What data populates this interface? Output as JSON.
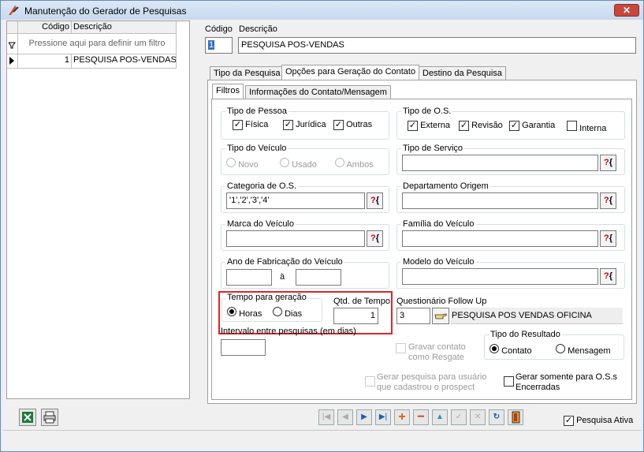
{
  "window": {
    "title": "Manutenção do Gerador de Pesquisas",
    "close": "✕"
  },
  "list": {
    "col_code": "Código",
    "col_desc": "Descrição",
    "filter_hint": "Pressione aqui para definir um filtro",
    "rows": [
      {
        "code": "1",
        "desc": "PESQUISA POS-VENDAS"
      }
    ]
  },
  "header": {
    "code_label": "Código",
    "desc_label": "Descrição",
    "code_value": "1",
    "desc_value": "PESQUISA POS-VENDAS"
  },
  "tabs": [
    "Tipo da Pesquisa",
    "Opções para Geração do Contato",
    "Destino da Pesquisa"
  ],
  "subtabs": [
    "Filtros",
    "Informações do Contato/Mensagem"
  ],
  "tipo_pessoa": {
    "label": "Tipo de Pessoa",
    "options": [
      {
        "label": "Física",
        "checked": true
      },
      {
        "label": "Jurídica",
        "checked": true
      },
      {
        "label": "Outras",
        "checked": true
      }
    ]
  },
  "tipo_os": {
    "label": "Tipo de O.S.",
    "options": [
      {
        "label": "Externa",
        "checked": true
      },
      {
        "label": "Revisão",
        "checked": true
      },
      {
        "label": "Garantia",
        "checked": true
      },
      {
        "label": "Interna",
        "checked": false
      }
    ]
  },
  "tipo_veiculo": {
    "label": "Tipo do Veículo",
    "options": [
      "Novo",
      "Usado",
      "Ambos"
    ]
  },
  "tipo_servico": {
    "label": "Tipo de Serviço",
    "value": ""
  },
  "categoria_os": {
    "label": "Categoria de O.S.",
    "value": "'1','2','3','4'"
  },
  "depto_origem": {
    "label": "Departamento Origem",
    "value": ""
  },
  "marca": {
    "label": "Marca do Veículo",
    "value": ""
  },
  "familia": {
    "label": "Família do Veículo",
    "value": ""
  },
  "ano": {
    "label": "Ano de Fabricação do Veículo",
    "sep": "à",
    "from": "",
    "to": ""
  },
  "modelo": {
    "label": "Modelo do Veículo",
    "value": ""
  },
  "tempo": {
    "label": "Tempo para geração",
    "options": [
      {
        "label": "Horas",
        "selected": true
      },
      {
        "label": "Dias",
        "selected": false
      }
    ]
  },
  "qtd_tempo": {
    "label": "Qtd. de Tempo",
    "value": "1"
  },
  "questionario": {
    "label": "Questionário Follow Up",
    "code": "3",
    "desc": "PESQUISA POS VENDAS OFICINA"
  },
  "intervalo": {
    "label": "Intervalo entre pesquisas (em dias)",
    "value": ""
  },
  "gravar": {
    "label1": "Gravar contato",
    "label2": "como Resgate"
  },
  "tipo_resultado": {
    "label": "Tipo do Resultado",
    "options": [
      {
        "label": "Contato",
        "selected": true
      },
      {
        "label": "Mensagem",
        "selected": false
      }
    ]
  },
  "gerar_usuario": {
    "label1": "Gerar pesquisa para usuário",
    "label2": "que cadastrou o prospect"
  },
  "gerar_os": {
    "label1": "Gerar somente para O.S.s",
    "label2": "Encerradas"
  },
  "ativa": {
    "label": "Pesquisa Ativa",
    "checked": true
  },
  "lookup_glyph": {
    "q": "?",
    "b": "{"
  },
  "colors": {
    "red_highlight": "#e0242a",
    "accent_blue": "#1a5fb4"
  }
}
